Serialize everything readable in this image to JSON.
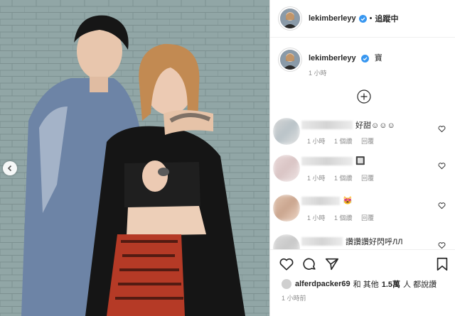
{
  "header": {
    "username": "lekimberleyy",
    "separator": "•",
    "follow_label": "追蹤中"
  },
  "caption": {
    "username": "lekimberleyy",
    "text": "寶",
    "time": "1 小時"
  },
  "comments": [
    {
      "text": "好甜☺☺☺",
      "time": "1 小時",
      "likes": "1 個讚",
      "reply": "回覆"
    },
    {
      "text": "🔲",
      "time": "1 小時",
      "likes": "1 個讚",
      "reply": "回覆"
    },
    {
      "text": "😻",
      "time": "1 小時",
      "likes": "1 個讚",
      "reply": "回覆"
    },
    {
      "text": "讚讚讚好閃呼ЛЛ",
      "time": "",
      "likes": "",
      "reply": ""
    }
  ],
  "likes": {
    "user": "alferdpacker69",
    "middle": "和 其他",
    "count": "1.5萬",
    "suffix": "人 都說讚"
  },
  "post_time": "1 小時前",
  "colors": {
    "verified": "#3897f0",
    "text": "#262626",
    "muted": "#8e8e8e"
  },
  "icons": [
    "verified-icon",
    "add-comment-icon",
    "heart-icon",
    "comment-icon",
    "share-icon",
    "bookmark-icon",
    "chevron-left-icon"
  ]
}
